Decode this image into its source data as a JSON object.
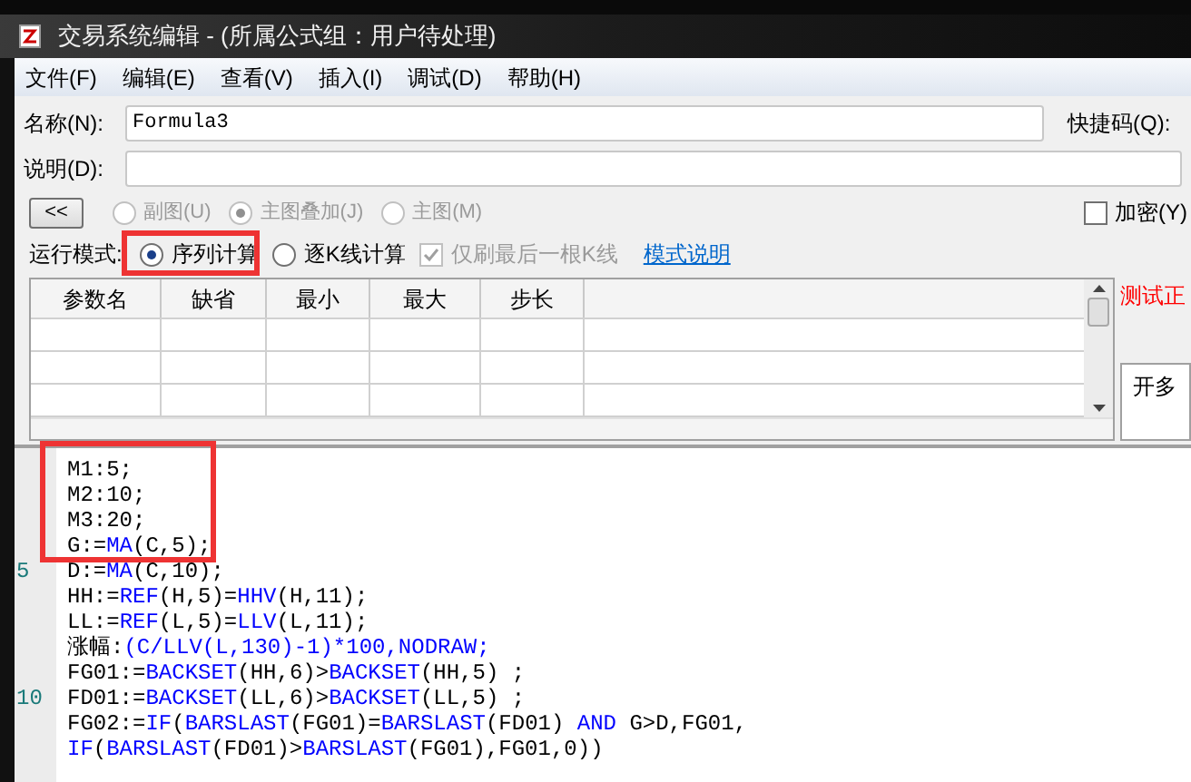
{
  "window": {
    "title": "交易系统编辑 - (所属公式组：用户待处理)"
  },
  "menu": [
    "文件(F)",
    "编辑(E)",
    "查看(V)",
    "插入(I)",
    "调试(D)",
    "帮助(H)"
  ],
  "name_field": {
    "label": "名称(N):",
    "value": "Formula3"
  },
  "shortcut_label": "快捷码(Q):",
  "description_field": {
    "label": "说明(D):"
  },
  "collapse_button": "<<",
  "chart_types": [
    {
      "label": "副图(U)",
      "selected": false,
      "disabled": true
    },
    {
      "label": "主图叠加(J)",
      "selected": true,
      "disabled": true
    },
    {
      "label": "主图(M)",
      "selected": false,
      "disabled": true
    }
  ],
  "encrypt": {
    "label": "加密(Y)",
    "checked": false
  },
  "run_mode": {
    "label": "运行模式:",
    "options": [
      {
        "label": "序列计算",
        "selected": true
      },
      {
        "label": "逐K线计算",
        "selected": false
      }
    ],
    "last_bar_only": {
      "label": "仅刷最后一根K线",
      "checked": true,
      "disabled": true
    },
    "help_link": "模式说明"
  },
  "params_table": {
    "columns": [
      "参数名",
      "缺省",
      "最小",
      "最大",
      "步长"
    ]
  },
  "test_status": "测试正",
  "signal_box": "开多",
  "code_lines": [
    {
      "tokens": [
        {
          "text": "M1:5;",
          "kind": "plain"
        }
      ]
    },
    {
      "tokens": [
        {
          "text": "M2:10;",
          "kind": "plain"
        }
      ]
    },
    {
      "tokens": [
        {
          "text": "M3:20;",
          "kind": "plain"
        }
      ]
    },
    {
      "tokens": [
        {
          "text": "G:=",
          "kind": "plain"
        },
        {
          "text": "MA",
          "kind": "keyword"
        },
        {
          "text": "(C,5);",
          "kind": "plain"
        }
      ]
    },
    {
      "line_number": "5",
      "tokens": [
        {
          "text": "D:=",
          "kind": "plain"
        },
        {
          "text": "MA",
          "kind": "keyword"
        },
        {
          "text": "(C,10);",
          "kind": "plain"
        }
      ]
    },
    {
      "tokens": [
        {
          "text": "HH:=",
          "kind": "plain"
        },
        {
          "text": "REF",
          "kind": "keyword"
        },
        {
          "text": "(H,5)=",
          "kind": "plain"
        },
        {
          "text": "HHV",
          "kind": "keyword"
        },
        {
          "text": "(H,11);",
          "kind": "plain"
        }
      ]
    },
    {
      "tokens": [
        {
          "text": "LL:=",
          "kind": "plain"
        },
        {
          "text": "REF",
          "kind": "keyword"
        },
        {
          "text": "(L,5)=",
          "kind": "plain"
        },
        {
          "text": "LLV",
          "kind": "keyword"
        },
        {
          "text": "(L,11);",
          "kind": "plain"
        }
      ]
    },
    {
      "tokens": [
        {
          "text": "涨幅:",
          "kind": "plain"
        },
        {
          "text": "(C/LLV(L,130)-1)*100,NODRAW;",
          "kind": "keyword"
        }
      ]
    },
    {
      "tokens": [
        {
          "text": "FG01:=",
          "kind": "plain"
        },
        {
          "text": "BACKSET",
          "kind": "keyword"
        },
        {
          "text": "(HH,6)>",
          "kind": "plain"
        },
        {
          "text": "BACKSET",
          "kind": "keyword"
        },
        {
          "text": "(HH,5) ;",
          "kind": "plain"
        }
      ]
    },
    {
      "line_number": "10",
      "tokens": [
        {
          "text": "FD01:=",
          "kind": "plain"
        },
        {
          "text": "BACKSET",
          "kind": "keyword"
        },
        {
          "text": "(LL,6)>",
          "kind": "plain"
        },
        {
          "text": "BACKSET",
          "kind": "keyword"
        },
        {
          "text": "(LL,5) ;",
          "kind": "plain"
        }
      ]
    },
    {
      "tokens": [
        {
          "text": "FG02:=",
          "kind": "plain"
        },
        {
          "text": "IF",
          "kind": "keyword"
        },
        {
          "text": "(",
          "kind": "plain"
        },
        {
          "text": "BARSLAST",
          "kind": "keyword"
        },
        {
          "text": "(FG01)=",
          "kind": "plain"
        },
        {
          "text": "BARSLAST",
          "kind": "keyword"
        },
        {
          "text": "(FD01) ",
          "kind": "plain"
        },
        {
          "text": "AND",
          "kind": "keyword"
        },
        {
          "text": " G>D,FG01,",
          "kind": "plain"
        }
      ]
    },
    {
      "tokens": [
        {
          "text": "IF",
          "kind": "keyword"
        },
        {
          "text": "(",
          "kind": "plain"
        },
        {
          "text": "BARSLAST",
          "kind": "keyword"
        },
        {
          "text": "(FD01)>",
          "kind": "plain"
        },
        {
          "text": "BARSLAST",
          "kind": "keyword"
        },
        {
          "text": "(FG01),FG01,0))",
          "kind": "plain"
        }
      ]
    }
  ]
}
